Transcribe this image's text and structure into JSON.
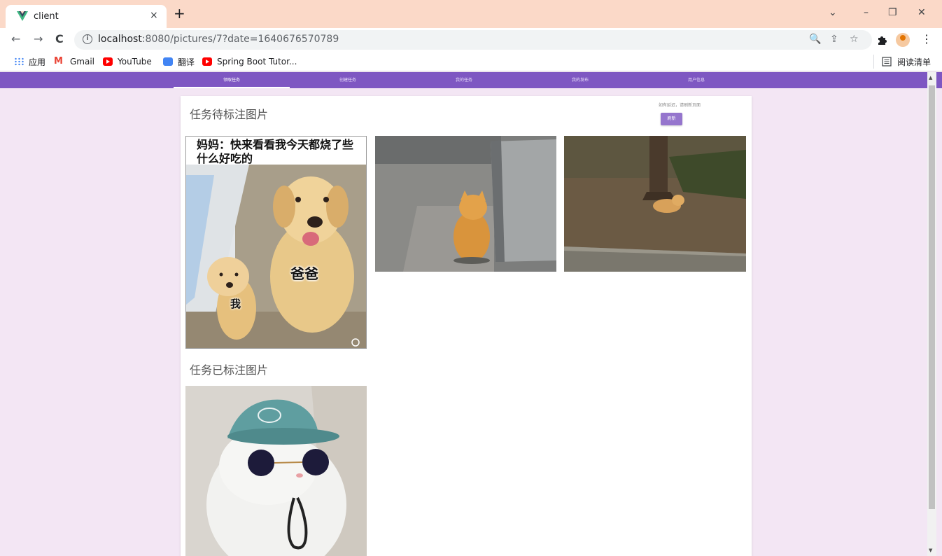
{
  "browser": {
    "tab_title": "client",
    "tab_close": "×",
    "new_tab": "+",
    "window_controls": [
      "⌄",
      "–",
      "❐",
      "✕"
    ],
    "url_host": "localhost",
    "url_path": ":8080/pictures/7?date=1640676570789",
    "nav": {
      "back": "←",
      "forward": "→",
      "reload": "C"
    },
    "omni_icons": [
      "🔍",
      "⇪",
      "☆"
    ],
    "extension_icon": "puzzle-icon",
    "menu": "⋮"
  },
  "bookmarks": {
    "items": [
      {
        "label": "应用",
        "icon": "apps-icon"
      },
      {
        "label": "Gmail",
        "icon": "gmail-icon"
      },
      {
        "label": "YouTube",
        "icon": "youtube-icon"
      },
      {
        "label": "翻译",
        "icon": "translate-icon"
      },
      {
        "label": "Spring Boot Tutor...",
        "icon": "youtube-icon"
      }
    ],
    "reading_list": "阅读清单"
  },
  "app_nav": {
    "items": [
      "领取任务",
      "创建任务",
      "我的任务",
      "我的发布",
      "用户信息"
    ],
    "active_index": 0,
    "color": "#7e57c2"
  },
  "main": {
    "pending_title": "任务待标注图片",
    "done_title": "任务已标注图片",
    "notice": "如有延迟，请刷新页面",
    "refresh_label": "刷新",
    "meme": {
      "caption": "妈妈：快来看看我今天都烧了些什么好吃的",
      "caption_line1": "妈妈：快来看看我今天都烧了些",
      "caption_line2": "什么好吃的",
      "label_dad": "爸爸",
      "label_me": "我"
    },
    "pending_images": [
      "meme-dogs-image",
      "cat-by-wall-image",
      "cat-under-tree-image"
    ],
    "done_images": [
      "cat-with-sunglasses-image"
    ]
  }
}
